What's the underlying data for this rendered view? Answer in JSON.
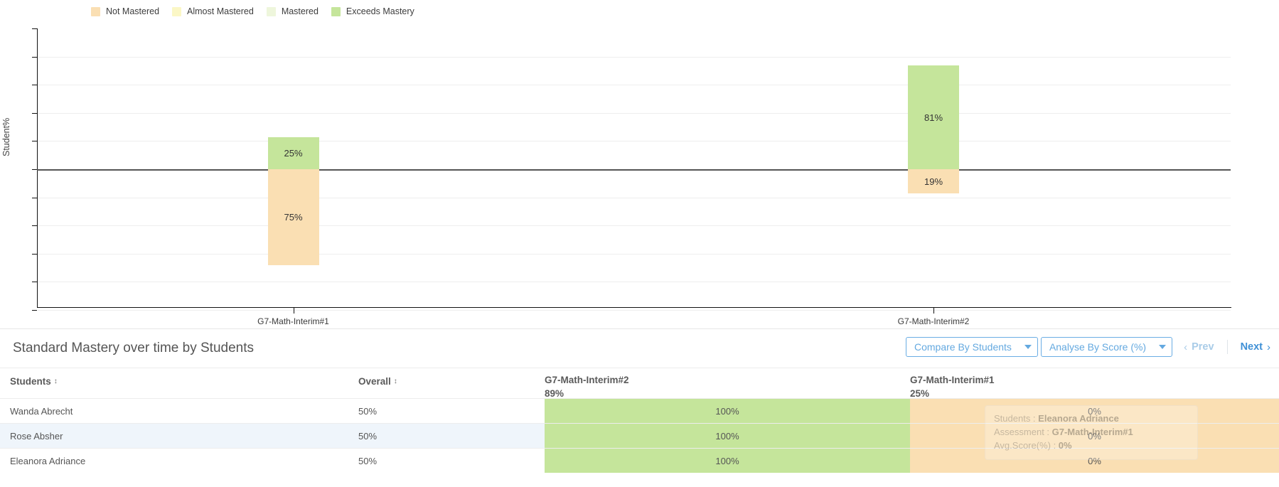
{
  "legend": {
    "items": [
      {
        "label": "Not Mastered",
        "color": "#fadfb3"
      },
      {
        "label": "Almost Mastered",
        "color": "#fbf7c6"
      },
      {
        "label": "Mastered",
        "color": "#eef6dc"
      },
      {
        "label": "Exceeds Mastery",
        "color": "#c5e59b"
      }
    ]
  },
  "chart_data": {
    "type": "bar",
    "title": "",
    "xlabel": "",
    "ylabel": "Student%",
    "grid": true,
    "legend_position": "top",
    "stacked": true,
    "baseline_value": 0,
    "ylim": [
      -100,
      100
    ],
    "categories": [
      "G7-Math-Interim#1",
      "G7-Math-Interim#2"
    ],
    "series": [
      {
        "name": "Exceeds Mastery",
        "color": "#c5e59b",
        "values": [
          25,
          81
        ],
        "labels": [
          "25%",
          "81%"
        ],
        "direction": "up"
      },
      {
        "name": "Not Mastered",
        "color": "#fadfb3",
        "values": [
          75,
          19
        ],
        "labels": [
          "75%",
          "19%"
        ],
        "direction": "down"
      }
    ],
    "bars": [
      {
        "category": "G7-Math-Interim#1",
        "segments": [
          {
            "series": "Exceeds Mastery",
            "value": 25,
            "label": "25%",
            "color": "#c5e59b"
          },
          {
            "series": "Not Mastered",
            "value": 75,
            "label": "75%",
            "color": "#fadfb3"
          }
        ]
      },
      {
        "category": "G7-Math-Interim#2",
        "segments": [
          {
            "series": "Exceeds Mastery",
            "value": 81,
            "label": "81%",
            "color": "#c5e59b"
          },
          {
            "series": "Not Mastered",
            "value": 19,
            "label": "19%",
            "color": "#fadfb3"
          }
        ]
      }
    ]
  },
  "panel": {
    "title": "Standard Mastery over time by Students",
    "compare_select": {
      "value": "Compare By Students"
    },
    "analyse_select": {
      "value": "Analyse By Score (%)"
    },
    "pager": {
      "prev": "Prev",
      "next": "Next",
      "prev_chevron": "‹",
      "next_chevron": "›"
    }
  },
  "table": {
    "columns": [
      {
        "key": "student",
        "label": "Students",
        "sortable": true,
        "sub": ""
      },
      {
        "key": "overall",
        "label": "Overall",
        "sortable": true,
        "sub": ""
      },
      {
        "key": "a2",
        "label": "G7-Math-Interim#2",
        "sortable": false,
        "sub": "89%"
      },
      {
        "key": "a1",
        "label": "G7-Math-Interim#1",
        "sortable": false,
        "sub": "25%"
      }
    ],
    "rows": [
      {
        "student": "Wanda Abrecht",
        "overall": "50%",
        "a2": "100%",
        "a2_color": "#c5e59b",
        "a1": "0%",
        "a1_color": "#fadfb3"
      },
      {
        "student": "Rose Absher",
        "overall": "50%",
        "a2": "100%",
        "a2_color": "#c5e59b",
        "a1": "0%",
        "a1_color": "#fadfb3"
      },
      {
        "student": "Eleanora Adriance",
        "overall": "50%",
        "a2": "100%",
        "a2_color": "#c5e59b",
        "a1": "0%",
        "a1_color": "#fadfb3"
      }
    ]
  },
  "tooltip": {
    "visible": true,
    "lines": [
      {
        "label": "Students : ",
        "value": "Eleanora Adriance"
      },
      {
        "label": "Assessment : ",
        "value": "G7-Math-Interim#1"
      },
      {
        "label": "Avg.Score(%) : ",
        "value": "0%"
      }
    ]
  },
  "colors": {
    "not_mastered": "#fadfb3",
    "almost_mastered": "#fbf7c6",
    "mastered": "#eef6dc",
    "exceeds_mastery": "#c5e59b",
    "accent_blue": "#64a9e0",
    "row_alt": "#eff5fb"
  }
}
